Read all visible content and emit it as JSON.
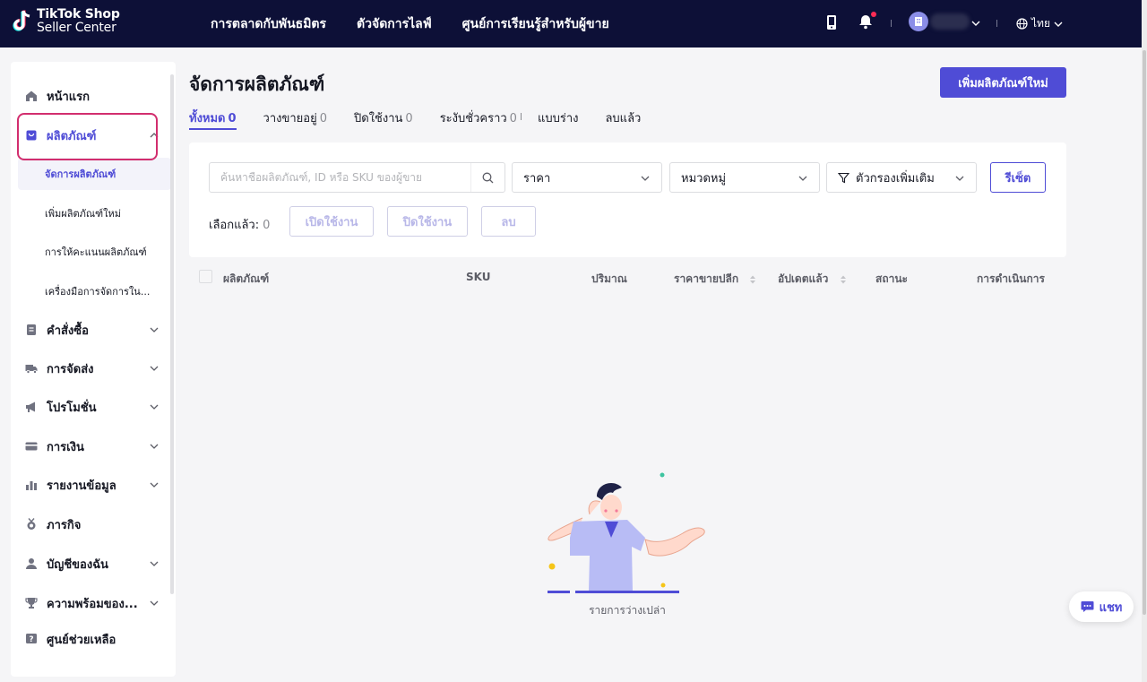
{
  "brand": {
    "line1": "TikTok Shop",
    "line2": "Seller Center"
  },
  "topnav": [
    "การตลาดกับพันธมิตร",
    "ตัวจัดการไลฟ์",
    "ศูนย์การเรียนรู้สำหรับผู้ขาย"
  ],
  "topbar": {
    "language": "ไทย"
  },
  "sidebar": {
    "items": [
      {
        "label": "หน้าแรก",
        "icon": "home-icon"
      },
      {
        "label": "ผลิตภัณฑ์",
        "icon": "product-bag-icon",
        "expanded": true
      },
      {
        "label": "คำสั่งซื้อ",
        "icon": "orders-icon"
      },
      {
        "label": "การจัดส่ง",
        "icon": "truck-icon"
      },
      {
        "label": "โปรโมชั่น",
        "icon": "megaphone-icon"
      },
      {
        "label": "การเงิน",
        "icon": "card-icon"
      },
      {
        "label": "รายงานข้อมูล",
        "icon": "bar-chart-icon"
      },
      {
        "label": "ภารกิจ",
        "icon": "medal-icon"
      },
      {
        "label": "บัญชีของฉัน",
        "icon": "user-icon"
      },
      {
        "label": "ความพร้อมของ...",
        "icon": "trophy-icon"
      },
      {
        "label": "ศูนย์ช่วยเหลือ",
        "icon": "help-icon"
      }
    ],
    "product_sub": [
      "จัดการผลิตภัณฑ์",
      "เพิ่มผลิตภัณฑ์ใหม่",
      "การให้คะแนนผลิตภัณฑ์",
      "เครื่องมือการจัดการใน..."
    ]
  },
  "main": {
    "title": "จัดการผลิตภัณฑ์",
    "add_button": "เพิ่มผลิตภัณฑ์ใหม่",
    "tabs": [
      {
        "label": "ทั้งหมด",
        "count": "0"
      },
      {
        "label": "วางขายอยู่",
        "count": "0"
      },
      {
        "label": "ปิดใช้งาน",
        "count": "0"
      },
      {
        "label": "ระงับชั่วคราว",
        "count": "0"
      },
      {
        "label": "แบบร่าง",
        "count": ""
      },
      {
        "label": "ลบแล้ว",
        "count": ""
      }
    ],
    "filters": {
      "search_placeholder": "ค้นหาชื่อผลิตภัณฑ์, ID หรือ SKU ของผู้ขาย",
      "price": "ราคา",
      "category": "หมวดหมู่",
      "more": "ตัวกรองเพิ่มเติม",
      "reset": "รีเซ็ต"
    },
    "selection": {
      "label": "เลือกแล้ว:",
      "count": "0",
      "enable": "เปิดใช้งาน",
      "disable": "ปิดใช้งาน",
      "delete": "ลบ"
    },
    "table_headers": [
      "ผลิตภัณฑ์",
      "SKU",
      "ปริมาณ",
      "ราคาขายปลีก",
      "อัปเดตแล้ว",
      "สถานะ",
      "การดำเนินการ"
    ],
    "empty_text": "รายการว่างเปล่า"
  },
  "chat": {
    "label": "แชท"
  },
  "colors": {
    "accent": "#4f4cd6",
    "topbar": "#0d1037",
    "highlight": "#d22e6e",
    "notify": "#fe2c55"
  }
}
